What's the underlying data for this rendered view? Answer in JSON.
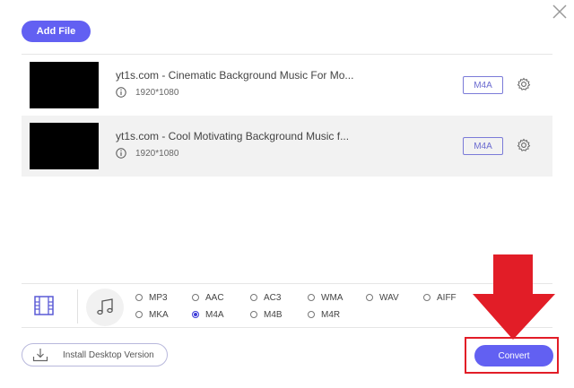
{
  "toolbar": {
    "add_file_label": "Add File"
  },
  "files": [
    {
      "name": "yt1s.com - Cinematic Background Music For Mo...",
      "resolution": "1920*1080",
      "format": "M4A"
    },
    {
      "name": "yt1s.com - Cool Motivating Background Music f...",
      "resolution": "1920*1080",
      "format": "M4A"
    }
  ],
  "formats": {
    "row1": [
      "MP3",
      "AAC",
      "AC3",
      "WMA",
      "WAV",
      "AIFF"
    ],
    "row2": [
      "MKA",
      "M4A",
      "M4B",
      "M4R"
    ],
    "selected": "M4A"
  },
  "footer": {
    "install_label": "Install Desktop Version",
    "convert_label": "Convert"
  },
  "colors": {
    "accent": "#6260f2",
    "highlight": "#e21d27"
  }
}
